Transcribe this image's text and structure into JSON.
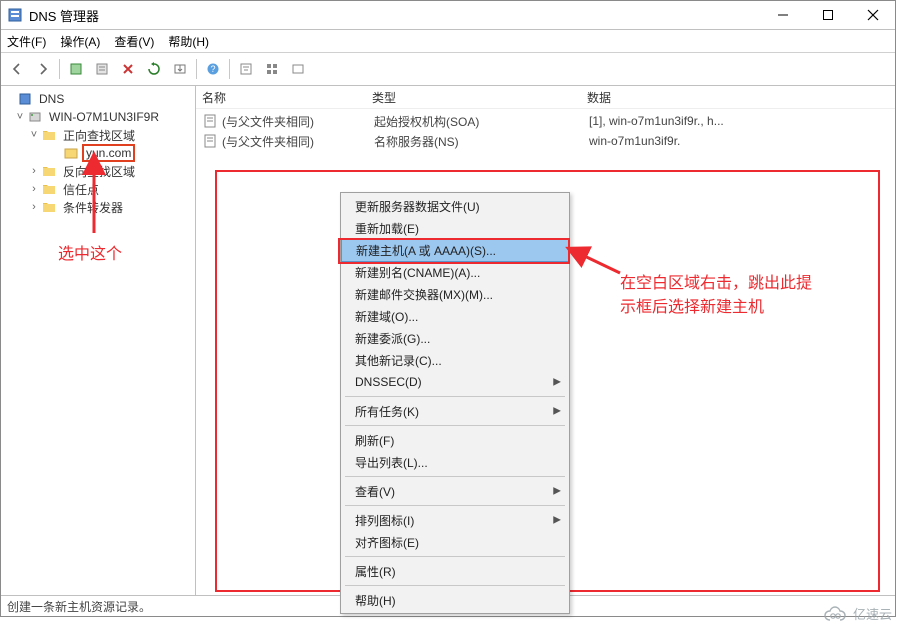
{
  "window": {
    "title": "DNS 管理器"
  },
  "menus": {
    "file": "文件(F)",
    "action": "操作(A)",
    "view": "查看(V)",
    "help": "帮助(H)"
  },
  "tree": {
    "root": "DNS",
    "server": "WIN-O7M1UN3IF9R",
    "fwd_zone": "正向查找区域",
    "domain": "yun.com",
    "rev_zone": "反向查找区域",
    "trust_points": "信任点",
    "cond_fwd": "条件转发器"
  },
  "columns": {
    "name": "名称",
    "type": "类型",
    "data": "数据"
  },
  "rows": [
    {
      "name": "(与父文件夹相同)",
      "type": "起始授权机构(SOA)",
      "data": "[1], win-o7m1un3if9r., h..."
    },
    {
      "name": "(与父文件夹相同)",
      "type": "名称服务器(NS)",
      "data": "win-o7m1un3if9r."
    }
  ],
  "context_menu": {
    "update_file": "更新服务器数据文件(U)",
    "reload": "重新加载(E)",
    "new_host": "新建主机(A 或 AAAA)(S)...",
    "new_alias": "新建别名(CNAME)(A)...",
    "new_mx": "新建邮件交换器(MX)(M)...",
    "new_domain": "新建域(O)...",
    "new_delegation": "新建委派(G)...",
    "other_new": "其他新记录(C)...",
    "dnssec": "DNSSEC(D)",
    "all_tasks": "所有任务(K)",
    "refresh": "刷新(F)",
    "export_list": "导出列表(L)...",
    "view": "查看(V)",
    "arrange_icons": "排列图标(I)",
    "align_icons": "对齐图标(E)",
    "properties": "属性(R)",
    "help": "帮助(H)"
  },
  "statusbar": "创建一条新主机资源记录。",
  "annotations": {
    "left": "选中这个",
    "right_l1": "在空白区域右击，跳出此提",
    "right_l2": "示框后选择新建主机"
  },
  "watermark": "亿速云"
}
